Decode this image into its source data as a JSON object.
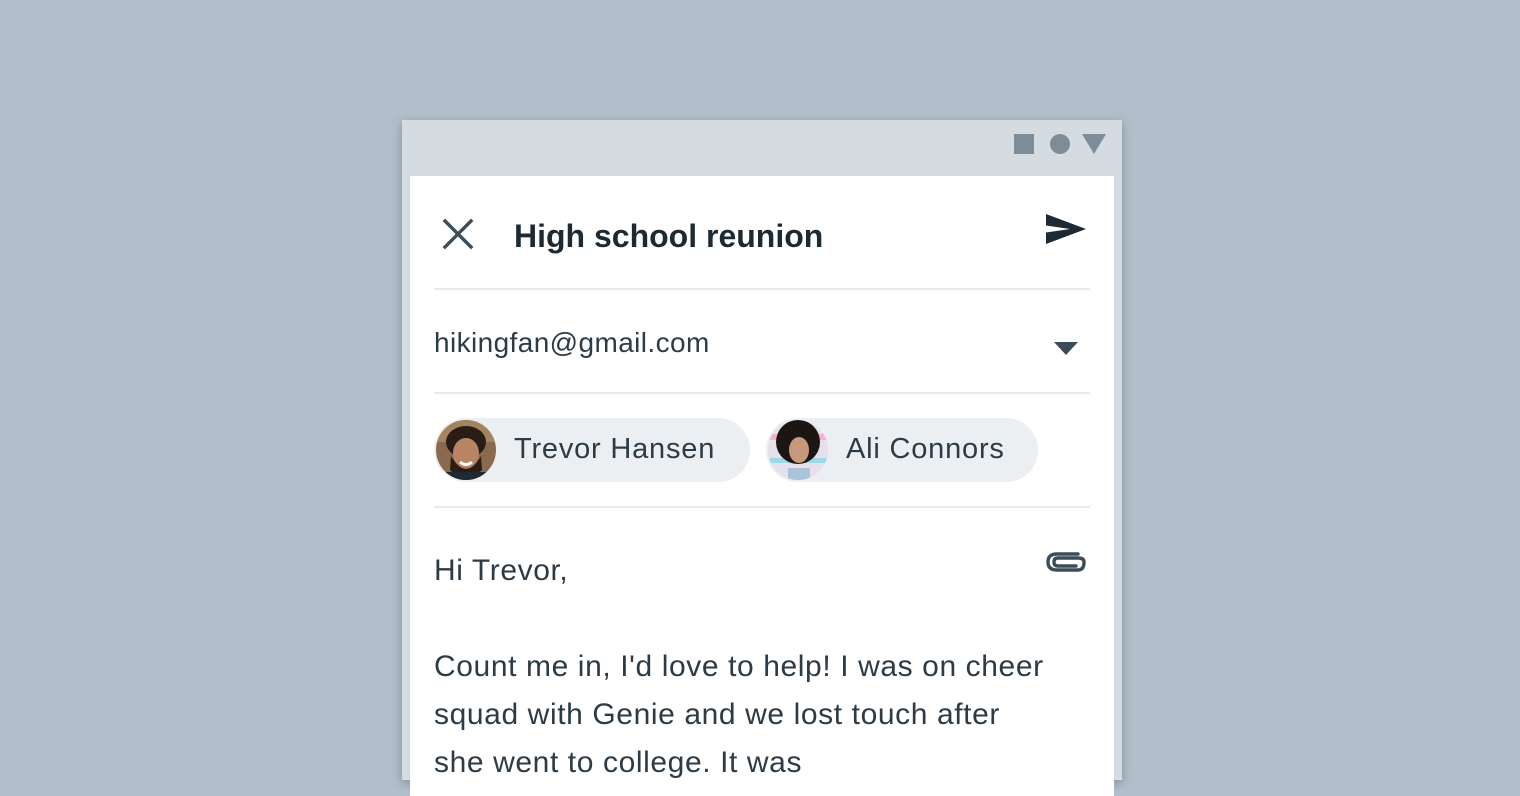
{
  "window": {
    "controls": [
      "square-icon",
      "circle-icon",
      "triangle-icon"
    ]
  },
  "header": {
    "close_icon": "close-icon",
    "subject": "High school reunion",
    "send_icon": "send-icon"
  },
  "from": {
    "value": "hikingfan@gmail.com",
    "dropdown_icon": "chevron-down-icon"
  },
  "recipients": [
    {
      "name": "Trevor Hansen",
      "avatar": "avatar-trevor"
    },
    {
      "name": "Ali Connors",
      "avatar": "avatar-ali"
    }
  ],
  "body": {
    "attach_icon": "paperclip-icon",
    "greeting": "Hi Trevor,",
    "paragraph": "Count me in, I'd love to help! I was on cheer squad with Genie and we lost touch after she went to college. It was"
  },
  "colors": {
    "background": "#b2bfca",
    "titlebar": "#d4dce2",
    "chip": "#eceff1",
    "text": "#2c3b45",
    "icon": "#3b4d59"
  }
}
